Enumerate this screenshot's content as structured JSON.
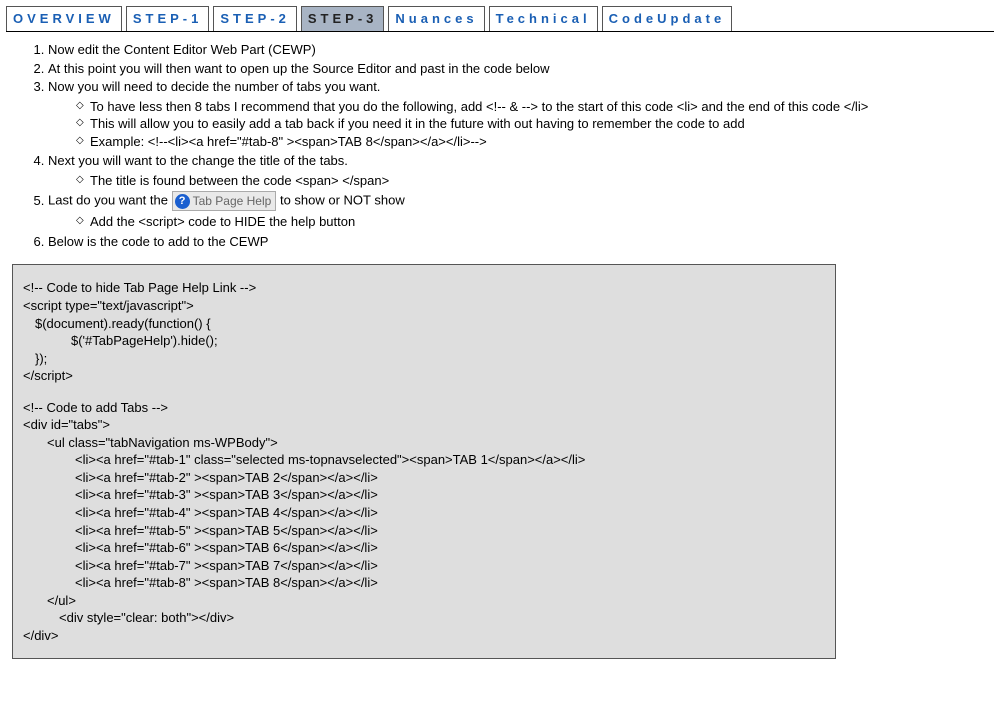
{
  "tabs": [
    {
      "label": "OVERVIEW",
      "selected": false
    },
    {
      "label": "STEP-1",
      "selected": false
    },
    {
      "label": "STEP-2",
      "selected": false
    },
    {
      "label": "STEP-3",
      "selected": true
    },
    {
      "label": "Nuances",
      "selected": false
    },
    {
      "label": "Technical",
      "selected": false
    },
    {
      "label": "CodeUpdate",
      "selected": false
    }
  ],
  "steps": {
    "s1": "Now edit the Content Editor Web Part (CEWP)",
    "s2": "At this point you will then want to open up the Source Editor and past in the code below",
    "s3": "Now you will need to decide the number of tabs you want.",
    "s3a": "To have less then 8 tabs I recommend that you do the following, add <!--  & --> to the start of this code <li> and the end of this code </li>",
    "s3b": "This will allow you to easily add a tab back if you need it in the future with out having to remember the code to add",
    "s3c": "Example: <!--<li><a href=\"#tab-8\" ><span>TAB 8</span></a></li>-->",
    "s4": " Next you will want to the change the title of the tabs.",
    "s4a": "The title is found between the code <span>  </span>",
    "s5a": "Last do you want the ",
    "s5b": " to show or NOT show",
    "s5sub": "Add the <script> code to HIDE the help button",
    "s6": "Below is the code to add to the CEWP",
    "help_label": "Tab Page Help"
  },
  "code": {
    "c1": "<!-- Code to hide Tab Page Help Link -->",
    "c2": "<script type=\"text/javascript\">",
    "c3": "$(document).ready(function() {",
    "c4": "$('#TabPageHelp').hide();",
    "c5": "});",
    "c6": "</script>",
    "c7": "<!-- Code to add Tabs -->",
    "c8": "<div id=\"tabs\">",
    "c9": "<ul class=\"tabNavigation ms-WPBody\">",
    "c10": "<li><a href=\"#tab-1\" class=\"selected ms-topnavselected\"><span>TAB 1</span></a></li>",
    "c11": "<li><a href=\"#tab-2\" ><span>TAB 2</span></a></li>",
    "c12": "<li><a href=\"#tab-3\" ><span>TAB 3</span></a></li>",
    "c13": "<li><a href=\"#tab-4\" ><span>TAB 4</span></a></li>",
    "c14": "<li><a href=\"#tab-5\" ><span>TAB 5</span></a></li>",
    "c15": "<li><a href=\"#tab-6\" ><span>TAB 6</span></a></li>",
    "c16": "<li><a href=\"#tab-7\" ><span>TAB 7</span></a></li>",
    "c17": "<li><a href=\"#tab-8\" ><span>TAB 8</span></a></li>",
    "c18": "</ul>",
    "c19": "<div style=\"clear: both\"></div>",
    "c20": "</div>"
  }
}
